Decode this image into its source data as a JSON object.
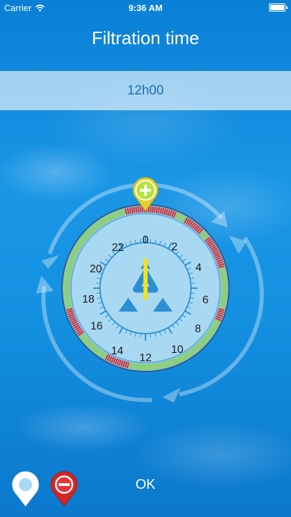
{
  "status_bar": {
    "carrier": "Carrier",
    "time": "9:36 AM"
  },
  "header": {
    "title": "Filtration time"
  },
  "filtration_value": "12h00",
  "clock": {
    "hour_labels": [
      "0",
      "2",
      "4",
      "6",
      "8",
      "10",
      "12",
      "14",
      "16",
      "18",
      "20",
      "22"
    ],
    "segment_states": [
      "red",
      "red",
      "red",
      "red",
      "red",
      "red",
      "red",
      "red",
      "red",
      "red",
      "red",
      "red",
      "red",
      "red",
      "red",
      "green",
      "green",
      "green",
      "green",
      "green",
      "red",
      "red",
      "red",
      "red",
      "red",
      "red",
      "red",
      "red",
      "red",
      "red",
      "green",
      "green",
      "green",
      "green",
      "red",
      "red",
      "red",
      "red",
      "red",
      "red",
      "red",
      "red",
      "red",
      "red",
      "red",
      "red",
      "red",
      "red",
      "red",
      "red",
      "green",
      "green",
      "green",
      "green",
      "green",
      "green",
      "green",
      "green",
      "green",
      "green",
      "green",
      "green",
      "green",
      "green",
      "green",
      "green",
      "green",
      "green",
      "green",
      "green",
      "red",
      "red",
      "red",
      "red",
      "red",
      "red",
      "green",
      "green",
      "green",
      "green",
      "green",
      "green",
      "green",
      "green",
      "green",
      "green",
      "green",
      "green",
      "green",
      "green",
      "green",
      "green",
      "green",
      "green",
      "green",
      "green",
      "green",
      "green",
      "green",
      "green",
      "green",
      "green",
      "green",
      "green",
      "green",
      "green",
      "green",
      "green",
      "green",
      "green",
      "green",
      "green",
      "green",
      "green",
      "green",
      "green",
      "green",
      "green",
      "green",
      "green",
      "green",
      "green",
      "green",
      "green",
      "green",
      "green",
      "green",
      "green",
      "red",
      "red",
      "red",
      "red",
      "red",
      "red",
      "red",
      "red",
      "red",
      "red",
      "red",
      "red",
      "green",
      "green",
      "green",
      "green",
      "green",
      "green",
      "green",
      "green",
      "green",
      "green",
      "green",
      "green",
      "green",
      "green",
      "green",
      "green",
      "red",
      "red",
      "red",
      "red",
      "red",
      "red",
      "red",
      "red",
      "red",
      "red",
      "red",
      "red",
      "red",
      "red",
      "green",
      "green",
      "green",
      "green",
      "green",
      "green",
      "green",
      "green",
      "green",
      "green",
      "green",
      "green",
      "green",
      "green",
      "green",
      "green",
      "green",
      "green",
      "green",
      "green",
      "green",
      "green",
      "green",
      "green",
      "green",
      "green",
      "green",
      "green",
      "green",
      "green",
      "green",
      "green",
      "green",
      "green",
      "green",
      "green",
      "green",
      "green",
      "green",
      "green",
      "green",
      "green",
      "green",
      "green",
      "green",
      "green",
      "green",
      "green",
      "green",
      "green",
      "green",
      "green",
      "green",
      "green",
      "green",
      "green",
      "green",
      "green",
      "green",
      "green",
      "red",
      "red",
      "red",
      "red",
      "red",
      "red",
      "red",
      "red",
      "red",
      "red"
    ],
    "hand_hour": 0,
    "colors": {
      "on": "#8cd43a",
      "off": "#e41c1c",
      "hand": "#f4e21a",
      "face": "#a9d8f3"
    }
  },
  "buttons": {
    "ok_label": "OK"
  },
  "icons": {
    "plus_marker": "plus-marker-icon",
    "recycle": "recycle-icon",
    "empty_marker": "empty-marker-icon",
    "minus_marker": "minus-marker-icon"
  }
}
